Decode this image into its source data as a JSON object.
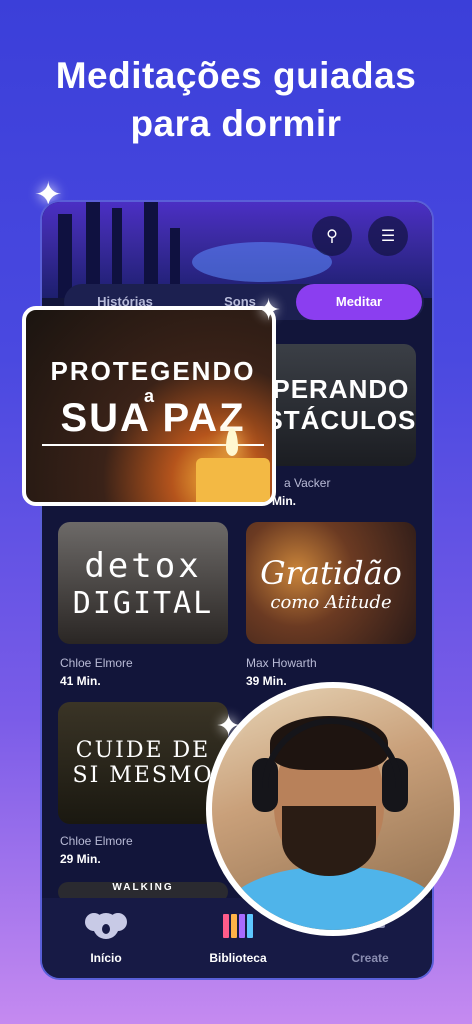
{
  "headline": {
    "line1": "Meditações guiadas",
    "line2": "para dormir"
  },
  "search_icon": "search-icon",
  "filter_icon": "filter-icon",
  "tabs": [
    {
      "label": "Histórias",
      "active": false
    },
    {
      "label": "Sons",
      "active": false
    },
    {
      "label": "Meditar",
      "active": true
    }
  ],
  "featured": {
    "title_top": "PROTEGENDO",
    "title_a": "a",
    "title_bottom": "SUA PAZ"
  },
  "cards": [
    {
      "title": "SUPERANDO OBSTÁCULOS",
      "title_line1": "UPERANDO",
      "title_line2": "BSTÁCULOS",
      "author": "a Vacker",
      "duration": "Min."
    },
    {
      "title": "detox DIGITAL",
      "title_line1": "detox",
      "title_line2": "DIGITAL",
      "author": "Chloe Elmore",
      "duration": "41 Min."
    },
    {
      "title": "Gratidão como Atitude",
      "title_line1": "Gratidão",
      "title_line2": "como Atitude",
      "author": "Max Howarth",
      "duration": "39 Min."
    },
    {
      "title": "CUIDE DE SI MESMO",
      "title_line1": "CUIDE DE",
      "title_line2": "SI MESMO",
      "author": "Chloe Elmore",
      "duration": "29 Min."
    }
  ],
  "partial_card_title": "WALKING",
  "nav": [
    {
      "label": "Início",
      "icon": "koala-icon"
    },
    {
      "label": "Biblioteca",
      "icon": "library-icon"
    },
    {
      "label": "Create",
      "icon": "create-icon"
    }
  ],
  "colors": {
    "accent": "#8b3ef0",
    "background_top": "#3b3fd9",
    "phone_bg": "#12153a"
  }
}
